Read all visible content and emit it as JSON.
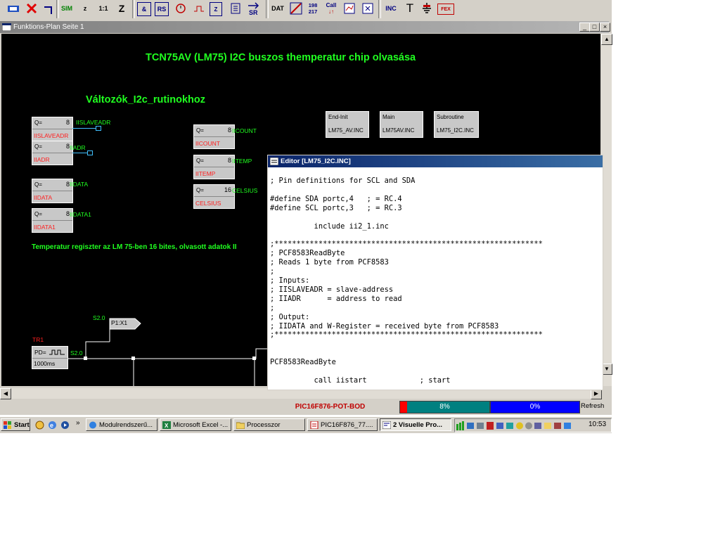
{
  "toolbar": {
    "buttons": [
      "SIM",
      "z",
      "1:1",
      "Z",
      "&",
      "RS",
      "Z",
      "DAT",
      "198",
      "217",
      "Call",
      "INC",
      "T",
      "FEX"
    ]
  },
  "window": {
    "title": "Funktions-Plan Seite 1"
  },
  "canvas": {
    "main_title": "TCN75AV (LM75) I2C buszos themperatur chip olvasása",
    "subtitle": "Változók_I2c_rutinokhoz",
    "comment": "Temperatur regiszter az LM 75-ben 16 bites, olvasott adatok II",
    "blocks": [
      {
        "q": "Q=",
        "n": "8",
        "name": "IISLAVEADR",
        "out": "IISLAVEADR"
      },
      {
        "q": "Q=",
        "n": "8",
        "name": "IIADR",
        "out": "IIADR"
      },
      {
        "q": "Q=",
        "n": "8",
        "name": "IIDATA",
        "out": "IIDATA"
      },
      {
        "q": "Q=",
        "n": "8",
        "name": "IIDATA1",
        "out": "IIDATA1"
      },
      {
        "q": "Q=",
        "n": "8",
        "name": "IICOUNT",
        "out": "IICOUNT"
      },
      {
        "q": "Q=",
        "n": "8",
        "name": "IITEMP",
        "out": "IITEMP"
      },
      {
        "q": "Q=",
        "n": "16",
        "name": "CELSIUS",
        "out": "CELSIUS"
      }
    ],
    "files": [
      {
        "type": "End-Init",
        "file": "LM75_AV.INC"
      },
      {
        "type": "Main",
        "file": "LM75AV.INC"
      },
      {
        "type": "Subroutine",
        "file": "LM75_I2C.INC"
      }
    ],
    "tr1_label": "TR1",
    "pd_label": "PD=",
    "pd_time": "1000ms",
    "s20_a": "S2.0",
    "s20_b": "S2.0",
    "p1x1": "P1:X1"
  },
  "editor": {
    "title": "Editor [LM75_I2C.INC]",
    "code": "; Pin definitions for SCL and SDA\n\n#define SDA portc,4   ; = RC.4\n#define SCL portc,3   ; = RC.3\n\n          include ii2_1.inc\n\n;*************************************************************\n; PCF8583ReadByte\n; Reads 1 byte from PCF8583\n;\n; Inputs:\n; IISLAVEADR = slave-address\n; IIADR      = address to read\n;\n; Output:\n; IIDATA and W-Register = received byte from PCF8583\n;*************************************************************\n\n\nPCF8583ReadByte\n\n          call iistart            ; start"
  },
  "status": {
    "device": "PIC16F876-POT-BOD",
    "progress1_label": "8%",
    "progress1_value": 0.08,
    "progress2_label": "0%",
    "progress2_value": 0,
    "refresh": "Refresh"
  },
  "taskbar": {
    "start": "Start",
    "tasks": [
      "Modulrendszerű...",
      "Microsoft Excel -...",
      "Processzor",
      "PIC16F876_77....",
      "2 Visuelle Pro..."
    ],
    "clock": "10:53"
  },
  "colors": {
    "canvas_bg": "#000000",
    "text_green": "#20ff20",
    "name_red": "#ff2020",
    "editor_title": "#0a246a",
    "progress1": "#008080",
    "progress2": "#0000ff"
  }
}
